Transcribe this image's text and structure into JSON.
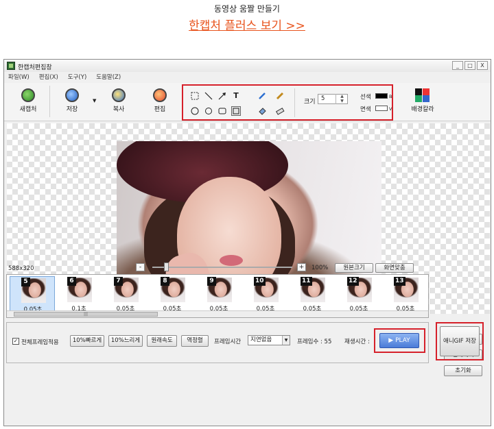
{
  "page": {
    "heading": "동영상 움짤 만들기",
    "link": "한캡처 플러스 보기 >>"
  },
  "window": {
    "title": "한캡처편집창",
    "controls": [
      "_",
      "□",
      "X"
    ],
    "menu": [
      "파일(W)",
      "편집(X)",
      "도구(Y)",
      "도움말(Z)"
    ]
  },
  "toolbar": {
    "new": "새캡처",
    "save": "저장",
    "copy": "복사",
    "edit": "편집",
    "size_label": "크기",
    "size_value": "5",
    "line_label": "선색",
    "line_key": "B",
    "fill_label": "면색",
    "fill_key": "V",
    "bgcolor": "배경칼라",
    "tool_text": "T",
    "colors": {
      "line": "#000000",
      "fill": "#ffffff",
      "highlight": "#d6202a"
    }
  },
  "canvas": {
    "size_text": "588x320",
    "zoom_percent": "100%",
    "zoom_minus": "-",
    "zoom_plus": "+",
    "original_size": "원본크기",
    "fit_screen": "화면맞춤"
  },
  "frames": [
    {
      "num": "5",
      "time": "0.05초"
    },
    {
      "num": "6",
      "time": "0.1초"
    },
    {
      "num": "7",
      "time": "0.05초"
    },
    {
      "num": "8",
      "time": "0.05초"
    },
    {
      "num": "9",
      "time": "0.05초"
    },
    {
      "num": "10",
      "time": "0.05초"
    },
    {
      "num": "11",
      "time": "0.05초"
    },
    {
      "num": "12",
      "time": "0.05초"
    },
    {
      "num": "13",
      "time": "0.05초"
    }
  ],
  "side_buttons": {
    "remove": "제거",
    "remove_all": "전체제거",
    "reset": "초기화"
  },
  "controls": {
    "apply_all": "전체프레임적용",
    "faster": "10%빠르게",
    "slower": "10%느리게",
    "original_speed": "원래속도",
    "reverse": "역정렬",
    "frame_time_label": "프레임시간",
    "frame_time_value": "지연없음",
    "frame_count": "프레임수 : 55",
    "play_time": "재생시간 :",
    "play": "▶ PLAY",
    "save_gif": "애니GIF 저장"
  }
}
